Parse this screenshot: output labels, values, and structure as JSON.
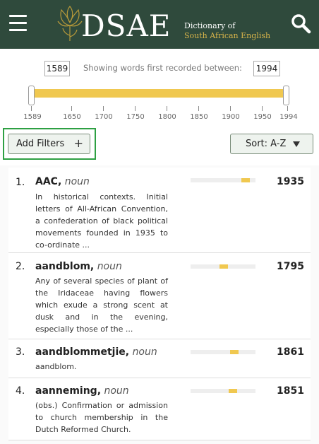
{
  "header": {
    "title": "DSAE",
    "subtitle_line1": "Dictionary of",
    "subtitle_line2": "South African English",
    "menu_icon": "hamburger-icon",
    "search_icon": "search-icon",
    "logo_icon": "protea-icon",
    "colors": {
      "background": "#2f4a3c",
      "accent": "#d8b44a"
    }
  },
  "range": {
    "start_year": "1589",
    "end_year": "1994",
    "label": "Showing words first recorded between:",
    "ticks": [
      "1589",
      "1650",
      "1700",
      "1750",
      "1800",
      "1850",
      "1900",
      "1950",
      "1994"
    ],
    "selected_fraction": [
      0,
      1
    ],
    "color": "#f0c850"
  },
  "controls": {
    "filters_label": "Add Filters",
    "filters_icon_label": "+",
    "sort_label": "Sort: A-Z"
  },
  "entries": [
    {
      "num": "1.",
      "word": "AAC,",
      "pos": "noun",
      "definition": "In historical contexts. Initial letters of All-African Convention, a confederation of black political movements founded in 1935 to co-ordinate ...",
      "year": "1935",
      "timeline_fraction": 0.85
    },
    {
      "num": "2.",
      "word": "aandblom,",
      "pos": "noun",
      "definition": "Any of several species of plant of the Iridaceae having flowers which exude a strong scent at dusk and in the evening, especially those of the ...",
      "year": "1795",
      "timeline_fraction": 0.51
    },
    {
      "num": "3.",
      "word": "aandblommetjie,",
      "pos": "noun",
      "definition": "aandblom.",
      "year": "1861",
      "timeline_fraction": 0.67
    },
    {
      "num": "4.",
      "word": "aanneming,",
      "pos": "noun",
      "definition": "(obs.) Confirmation or admission to church membership in the Dutch Reformed Church.",
      "year": "1851",
      "timeline_fraction": 0.65
    }
  ]
}
